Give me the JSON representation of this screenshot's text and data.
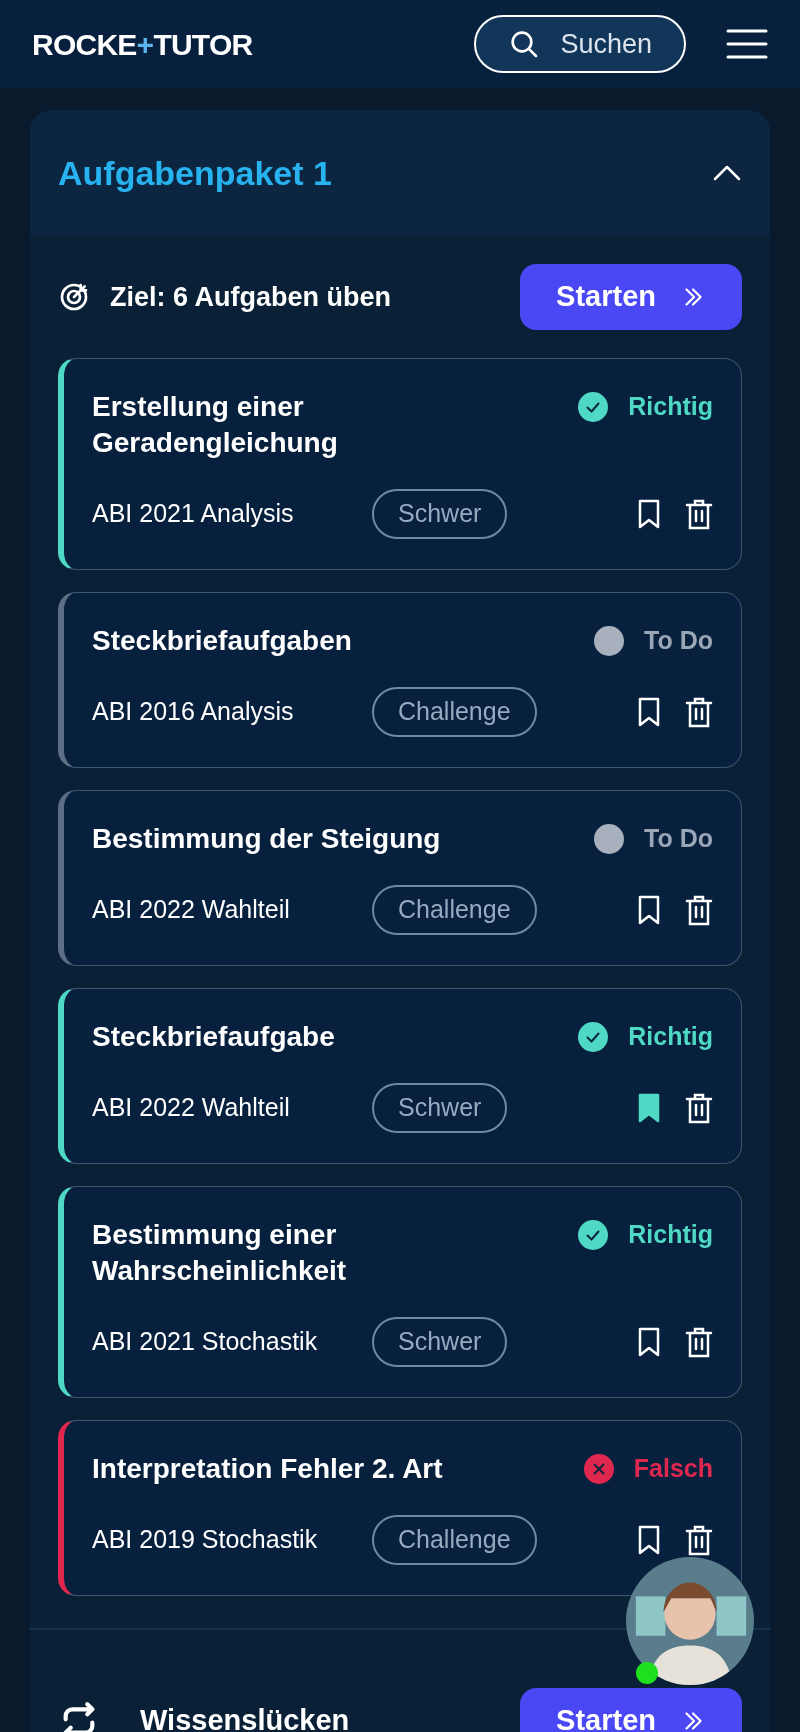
{
  "header": {
    "logo": {
      "text_1": "ROCKE",
      "mark": "+",
      "text_2": "TUTOR"
    },
    "search": {
      "label": "Suchen"
    }
  },
  "package": {
    "title": "Aufgabenpaket 1",
    "expanded": true,
    "goal": "Ziel: 6 Aufgaben üben",
    "start_button": "Starten",
    "tasks": [
      {
        "title": "Erstellung einer Geradengleichung",
        "kind": "correct",
        "status_label": "Richtig",
        "source": "ABI 2021 Analysis",
        "difficulty": "Schwer",
        "bookmarked": false
      },
      {
        "title": "Steckbriefaufgaben",
        "kind": "todo",
        "status_label": "To Do",
        "source": "ABI 2016 Analysis",
        "difficulty": "Challenge",
        "bookmarked": false
      },
      {
        "title": "Bestimmung der Steigung",
        "kind": "todo",
        "status_label": "To Do",
        "source": "ABI 2022 Wahlteil",
        "difficulty": "Challenge",
        "bookmarked": false
      },
      {
        "title": "Steckbriefaufgabe",
        "kind": "correct",
        "status_label": "Richtig",
        "source": "ABI 2022 Wahlteil",
        "difficulty": "Schwer",
        "bookmarked": true
      },
      {
        "title": "Bestimmung einer Wahrscheinlichkeit",
        "kind": "correct",
        "status_label": "Richtig",
        "source": "ABI 2021 Stochastik",
        "difficulty": "Schwer",
        "bookmarked": false
      },
      {
        "title": "Interpretation Fehler 2. Art",
        "kind": "wrong",
        "status_label": "Falsch",
        "source": "ABI 2019 Stochastik",
        "difficulty": "Challenge",
        "bookmarked": false
      }
    ]
  },
  "gaps": {
    "label": "Wissenslücken",
    "start_button": "Starten"
  },
  "assistant": {
    "online": true
  }
}
